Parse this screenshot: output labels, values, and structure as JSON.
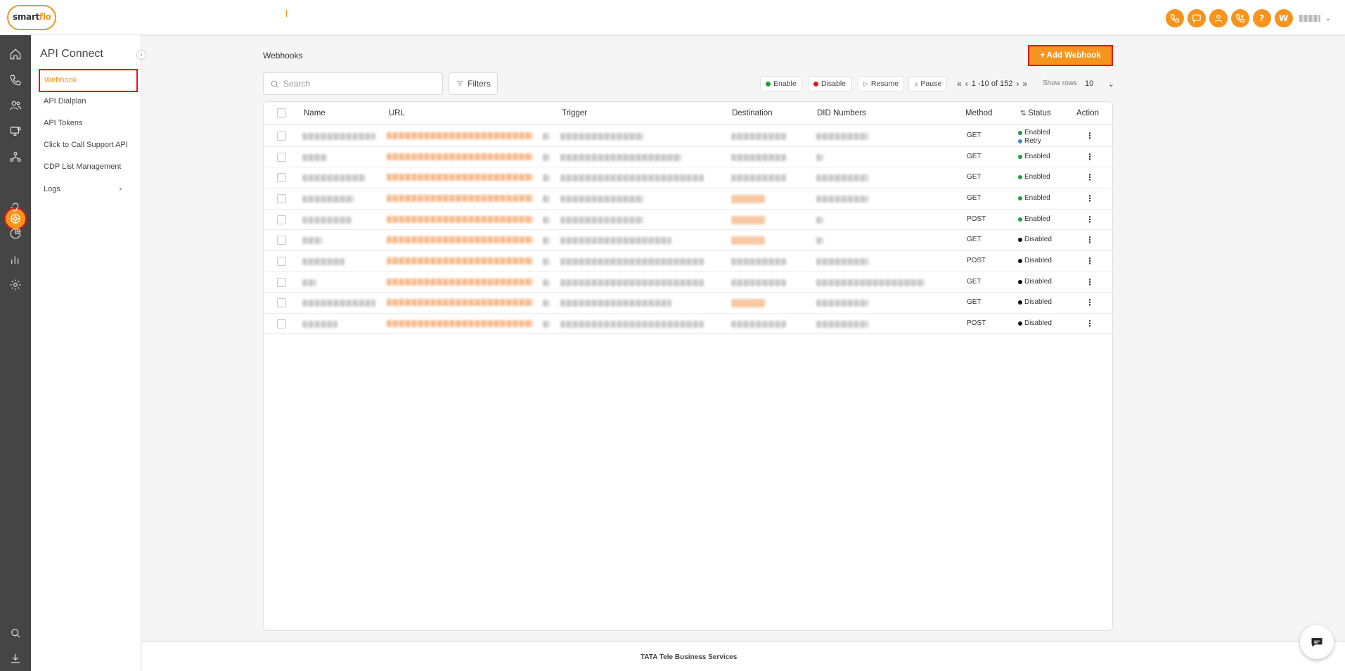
{
  "header": {
    "brand_part1": "smart",
    "brand_part2": "flo",
    "user_initial": "W"
  },
  "sidebar": {
    "title": "API Connect",
    "items": [
      {
        "label": "Webhook"
      },
      {
        "label": "API Dialplan"
      },
      {
        "label": "API Tokens"
      },
      {
        "label": "Click to Call Support API"
      },
      {
        "label": "CDP List Management"
      },
      {
        "label": "Logs"
      }
    ]
  },
  "page": {
    "title": "Webhooks",
    "add_button": "+ Add Webhook",
    "search_placeholder": "Search",
    "filters_label": "Filters"
  },
  "bulk_actions": {
    "enable": "Enable",
    "disable": "Disable",
    "resume": "Resume",
    "pause": "Pause"
  },
  "pagination": {
    "range": "1 -10 of 152",
    "show_rows_label": "Show rows",
    "rows": "10"
  },
  "table": {
    "columns": [
      "Name",
      "URL",
      "Trigger",
      "Destination",
      "DID Numbers",
      "Method",
      "Status",
      "Action"
    ],
    "rows": [
      {
        "method": "GET",
        "status": "Enabled",
        "status2": "Retry"
      },
      {
        "method": "GET",
        "status": "Enabled"
      },
      {
        "method": "GET",
        "status": "Enabled"
      },
      {
        "method": "GET",
        "status": "Enabled"
      },
      {
        "method": "POST",
        "status": "Enabled"
      },
      {
        "method": "GET",
        "status": "Disabled"
      },
      {
        "method": "POST",
        "status": "Disabled"
      },
      {
        "method": "GET",
        "status": "Disabled"
      },
      {
        "method": "GET",
        "status": "Disabled"
      },
      {
        "method": "POST",
        "status": "Disabled"
      }
    ]
  },
  "colors": {
    "accent": "#f7941d",
    "highlight_border": "#e01818",
    "enabled": "#1e9e3a",
    "disabled": "#111111",
    "retry": "#3a8fd6"
  },
  "footer": {
    "text": "TATA Tele Business Services"
  }
}
